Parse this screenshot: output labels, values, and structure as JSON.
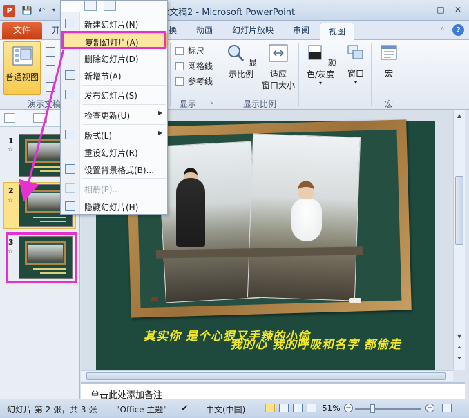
{
  "titlebar": {
    "app_icon": "P",
    "title": "示文稿2 - Microsoft PowerPoint",
    "icons": [
      "save-icon",
      "undo-icon",
      "customize-icon"
    ],
    "window_buttons": [
      "–",
      "□",
      "✕"
    ]
  },
  "tabs": {
    "file": "文件",
    "home": "开",
    "transitions": "换",
    "animations": "动画",
    "slideshow": "幻灯片放映",
    "review": "审阅",
    "view": "视图",
    "help": "?"
  },
  "ribbon": {
    "normal_view": "普通视图",
    "group_presentation_views": "演示文稿",
    "ruler": "标尺",
    "gridlines": "网格线",
    "guides": "参考线",
    "group_show": "显示",
    "zoom": "显示比例",
    "fit_to_window_line1": "适应",
    "fit_to_window_line2": "窗口大小",
    "group_zoom": "显示比例",
    "color_grayscale": "颜色/灰度",
    "window": "窗口",
    "macros": "宏",
    "group_macros": "宏"
  },
  "context_menu": {
    "items": [
      {
        "label": "新建幻灯片(N)",
        "icon": "new-slide-icon"
      },
      {
        "label": "复制幻灯片(A)",
        "icon": ""
      },
      {
        "label": "删除幻灯片(D)",
        "icon": ""
      },
      {
        "label": "新增节(A)",
        "icon": "new-section-icon"
      },
      {
        "label": "发布幻灯片(S)",
        "icon": "publish-icon"
      },
      {
        "label": "检查更新(U)",
        "icon": "",
        "submenu": true
      },
      {
        "label": "版式(L)",
        "icon": "layout-icon",
        "submenu": true
      },
      {
        "label": "重设幻灯片(R)",
        "icon": "reset-icon"
      },
      {
        "label": "设置背景格式(B)...",
        "icon": "background-icon"
      },
      {
        "label": "相册(P)...",
        "icon": "album-icon",
        "disabled": true
      },
      {
        "label": "隐藏幻灯片(H)",
        "icon": "hide-slide-icon"
      }
    ]
  },
  "slides_panel": {
    "slides": [
      {
        "number": "1",
        "star": "☆"
      },
      {
        "number": "2",
        "star": "☆"
      },
      {
        "number": "3",
        "star": "☆"
      }
    ]
  },
  "slide": {
    "line1": "其实你 是个心狠又手辣的小偷",
    "line2": "我的心 我的呼吸和名字 都偷走"
  },
  "notes": {
    "placeholder": "单击此处添加备注"
  },
  "statusbar": {
    "slide_info": "幻灯片 第 2 张，共 3 张",
    "theme": "\"Office 主题\"",
    "language": "中文(中国)",
    "zoom_level": "51%"
  },
  "colors": {
    "annotation": "#e431cf",
    "slide_background": "#1e4a3d",
    "slide_text": "#f0e62a",
    "file_tab": "#d24726"
  }
}
